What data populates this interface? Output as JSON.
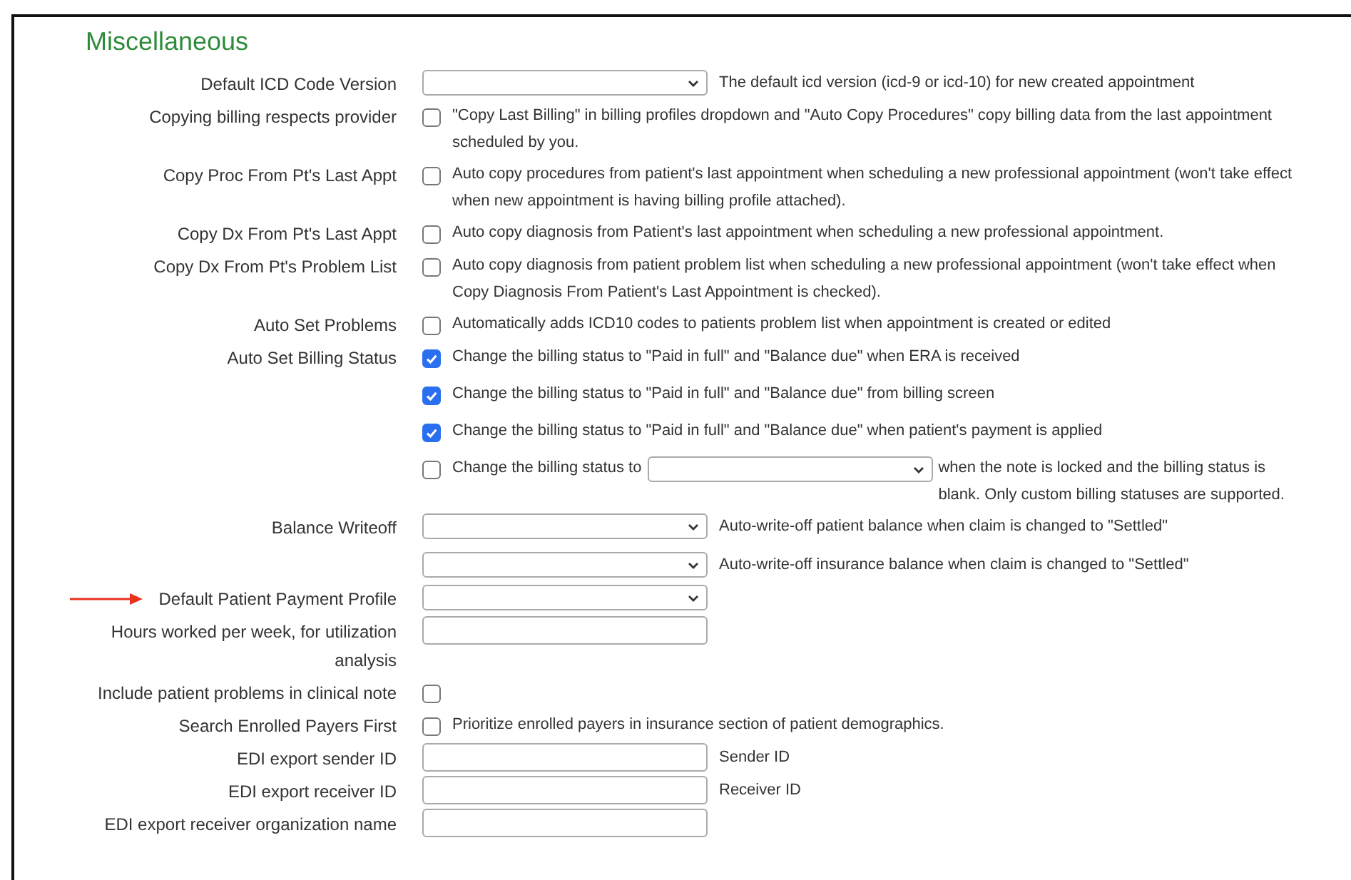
{
  "section_title": "Miscellaneous",
  "rows": [
    {
      "label": "Default ICD Code Version",
      "arrow": false,
      "items": [
        {
          "kind": "select",
          "text": "The default icd version (icd-9 or icd-10) for new created appointment"
        }
      ]
    },
    {
      "label": "Copying billing respects provider",
      "arrow": false,
      "items": [
        {
          "kind": "checkbox",
          "checked": false,
          "text": "\"Copy Last Billing\" in billing profiles dropdown and \"Auto Copy Procedures\" copy billing data from the last appointment scheduled by you."
        }
      ]
    },
    {
      "label": "Copy Proc From Pt's Last Appt",
      "arrow": false,
      "items": [
        {
          "kind": "checkbox",
          "checked": false,
          "text": "Auto copy procedures from patient's last appointment when scheduling a new professional appointment (won't take effect when new appointment is having billing profile attached)."
        }
      ]
    },
    {
      "label": "Copy Dx From Pt's Last Appt",
      "arrow": false,
      "items": [
        {
          "kind": "checkbox",
          "checked": false,
          "text": "Auto copy diagnosis from Patient's last appointment when scheduling a new professional appointment."
        }
      ]
    },
    {
      "label": "Copy Dx From Pt's Problem List",
      "arrow": false,
      "items": [
        {
          "kind": "checkbox",
          "checked": false,
          "text": "Auto copy diagnosis from patient problem list when scheduling a new professional appointment (won't take effect when Copy Diagnosis From Patient's Last Appointment is checked)."
        }
      ]
    },
    {
      "label": "Auto Set Problems",
      "arrow": false,
      "items": [
        {
          "kind": "checkbox",
          "checked": false,
          "text": "Automatically adds ICD10 codes to patients problem list when appointment is created or edited"
        }
      ]
    },
    {
      "label": "Auto Set Billing Status",
      "arrow": false,
      "items": [
        {
          "kind": "checkbox",
          "checked": true,
          "text": "Change the billing status to \"Paid in full\" and \"Balance due\" when ERA is received"
        },
        {
          "kind": "checkbox",
          "checked": true,
          "text": "Change the billing status to \"Paid in full\" and \"Balance due\" from billing screen"
        },
        {
          "kind": "checkbox",
          "checked": true,
          "text": "Change the billing status to \"Paid in full\" and \"Balance due\" when patient's payment is applied"
        },
        {
          "kind": "checkbox_select",
          "checked": false,
          "text_before": "Change the billing status to",
          "text_after": "when the note is locked and the billing status is blank. Only custom billing statuses are supported."
        }
      ]
    },
    {
      "label": "Balance Writeoff",
      "arrow": false,
      "items": [
        {
          "kind": "select",
          "text": "Auto-write-off patient balance when claim is changed to \"Settled\""
        },
        {
          "kind": "select",
          "text": "Auto-write-off insurance balance when claim is changed to \"Settled\""
        }
      ]
    },
    {
      "label": "Default Patient Payment Profile",
      "arrow": true,
      "items": [
        {
          "kind": "select"
        }
      ]
    },
    {
      "label": "Hours worked per week, for utilization analysis",
      "arrow": false,
      "items": [
        {
          "kind": "input"
        }
      ]
    },
    {
      "label": "Include patient problems in clinical note",
      "arrow": false,
      "items": [
        {
          "kind": "checkbox",
          "checked": false
        }
      ]
    },
    {
      "label": "Search Enrolled Payers First",
      "arrow": false,
      "items": [
        {
          "kind": "checkbox",
          "checked": false,
          "text": "Prioritize enrolled payers in insurance section of patient demographics."
        }
      ]
    },
    {
      "label": "EDI export sender ID",
      "arrow": false,
      "items": [
        {
          "kind": "input",
          "text": "Sender ID"
        }
      ]
    },
    {
      "label": "EDI export receiver ID",
      "arrow": false,
      "items": [
        {
          "kind": "input",
          "text": "Receiver ID"
        }
      ]
    },
    {
      "label": "EDI export receiver organization name",
      "arrow": false,
      "items": [
        {
          "kind": "input"
        }
      ]
    }
  ]
}
